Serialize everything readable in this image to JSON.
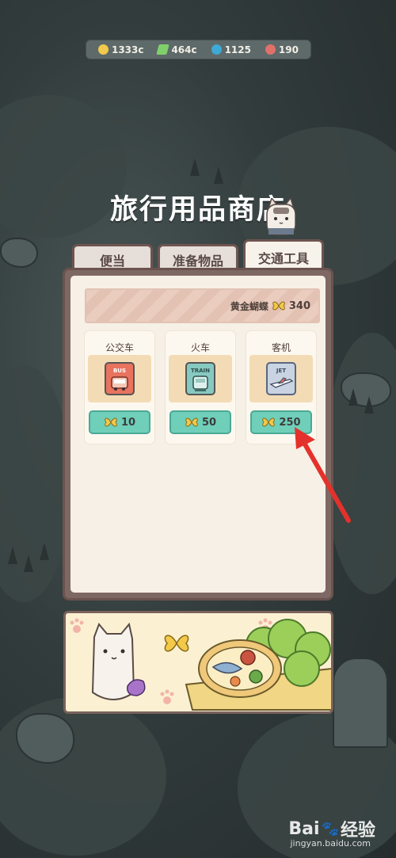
{
  "resources": [
    {
      "icon": "gold-clover-icon",
      "value": "1333c",
      "color": "#f2c94c"
    },
    {
      "icon": "green-lightning-icon",
      "value": "464c",
      "color": "#7fd06b"
    },
    {
      "icon": "blue-gem-icon",
      "value": "1125",
      "color": "#3fa9d6"
    },
    {
      "icon": "red-cookie-icon",
      "value": "190",
      "color": "#e0716a"
    }
  ],
  "title": "旅行用品商店",
  "tabs": [
    {
      "label": "便当",
      "active": false
    },
    {
      "label": "准备物品",
      "active": false
    },
    {
      "label": "交通工具",
      "active": true
    }
  ],
  "banner": {
    "label": "黄金蝴蝶",
    "count": "340"
  },
  "items": [
    {
      "name": "公交车",
      "ticket": "BUS",
      "ticket_color": "#e8735e",
      "price": "10"
    },
    {
      "name": "火车",
      "ticket": "TRAIN",
      "ticket_color": "#86c9c0",
      "price": "50"
    },
    {
      "name": "客机",
      "ticket": "JET",
      "ticket_color": "#8fa0b6",
      "price": "250"
    }
  ],
  "colors": {
    "accent": "#6fcfb9",
    "arrow": "#e5312b",
    "butterfly": "#f3c94a"
  },
  "watermark": {
    "brand": "Bai",
    "brand2": "经验",
    "url": "jingyan.baidu.com"
  }
}
